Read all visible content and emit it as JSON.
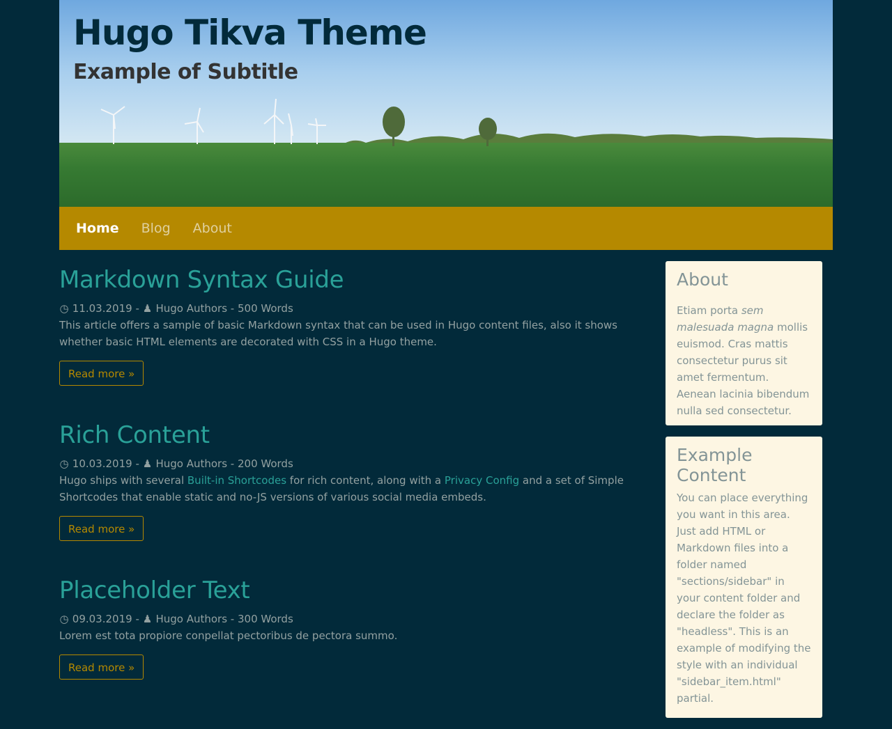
{
  "header": {
    "title": "Hugo Tikva Theme",
    "subtitle": "Example of Subtitle"
  },
  "nav": {
    "items": [
      {
        "label": "Home",
        "active": true
      },
      {
        "label": "Blog",
        "active": false
      },
      {
        "label": "About",
        "active": false
      }
    ]
  },
  "posts": [
    {
      "title": "Markdown Syntax Guide",
      "date": "11.03.2019",
      "author": "Hugo Authors",
      "words": "500 Words",
      "summary": "This article offers a sample of basic Markdown syntax that can be used in Hugo content files, also it shows whether basic HTML elements are decorated with CSS in a Hugo theme.",
      "read_more": "Read more »"
    },
    {
      "title": "Rich Content",
      "date": "10.03.2019",
      "author": "Hugo Authors",
      "words": "200 Words",
      "summary_parts": [
        "Hugo ships with several ",
        "Built-in Shortcodes",
        " for rich content, along with a ",
        "Privacy Config",
        " and a set of Simple Shortcodes that enable static and no-JS versions of various social media embeds."
      ],
      "read_more": "Read more »"
    },
    {
      "title": "Placeholder Text",
      "date": "09.03.2019",
      "author": "Hugo Authors",
      "words": "300 Words",
      "summary": "Lorem est tota propiore conpellat pectoribus de pectora summo.",
      "read_more": "Read more »"
    }
  ],
  "meta_separator": "-",
  "sidebar": {
    "about": {
      "title": "About",
      "text_before": "Etiam porta ",
      "text_em": "sem malesuada magna",
      "text_after": " mollis euismod. Cras mattis consectetur purus sit amet fermentum. Aenean lacinia bibendum nulla sed consectetur."
    },
    "example": {
      "title": "Example Content",
      "text": "You can place everything you want in this area. Just add HTML or Markdown files into a folder named \"sections/sidebar\" in your content folder and declare the folder as \"headless\". This is an example of modifying the style with an individual \"sidebar_item.html\" partial."
    }
  },
  "colors": {
    "background": "#022a3a",
    "accent": "#2aa198",
    "nav": "#b58900",
    "widget_bg": "#fdf6e3"
  },
  "icons": {
    "clock": "clock-icon",
    "user": "user-icon"
  }
}
